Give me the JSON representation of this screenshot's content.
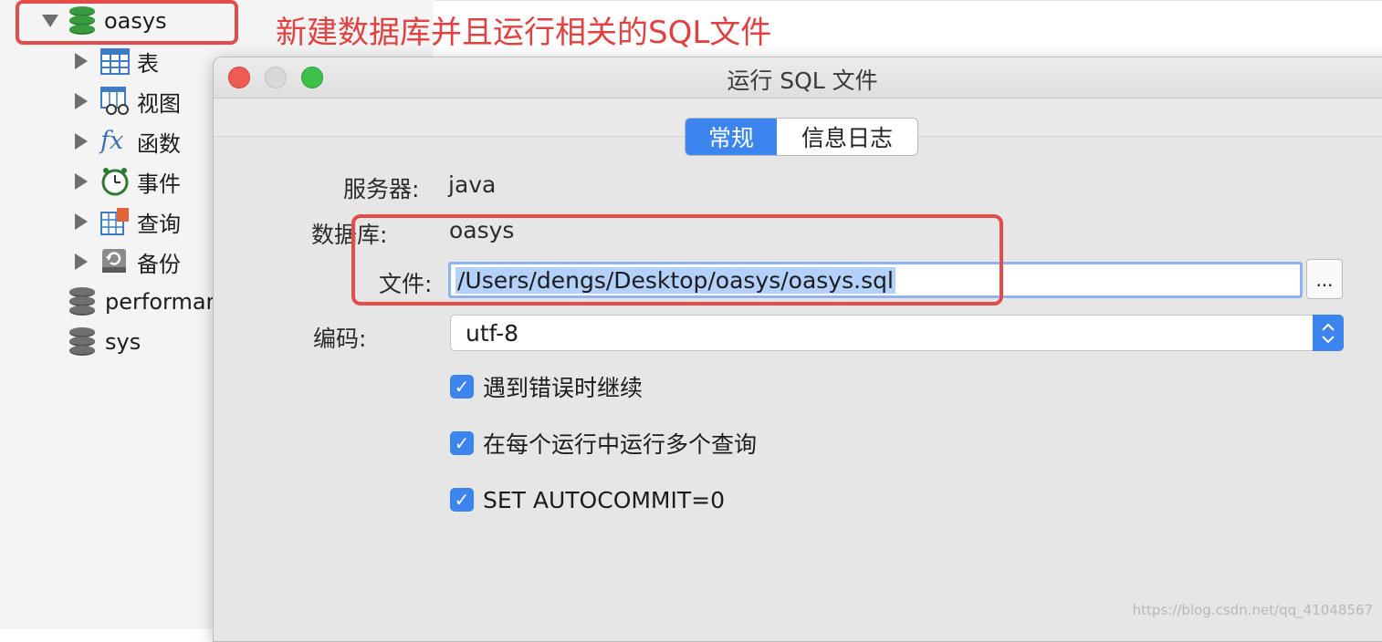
{
  "annotation": "新建数据库并且运行相关的SQL文件",
  "sidebar": {
    "db_open": "oasys",
    "children": [
      "表",
      "视图",
      "函数",
      "事件",
      "查询",
      "备份"
    ],
    "other_dbs": [
      "performance",
      "sys"
    ]
  },
  "dialog": {
    "title": "运行 SQL 文件",
    "tabs": [
      "常规",
      "信息日志"
    ],
    "server_label": "服务器:",
    "server_value": "java",
    "database_label": "数据库:",
    "database_value": "oasys",
    "file_label": "文件:",
    "file_value": "/Users/dengs/Desktop/oasys/oasys.sql",
    "browse_label": "...",
    "encoding_label": "编码:",
    "encoding_value": "utf-8",
    "options": [
      "遇到错误时继续",
      "在每个运行中运行多个查询",
      "SET AUTOCOMMIT=0"
    ]
  },
  "colors": {
    "annotation_red": "#e04141",
    "accent_blue": "#3d85ee",
    "db_green": "#3a9a3f"
  },
  "watermark": "https://blog.csdn.net/qq_41048567"
}
